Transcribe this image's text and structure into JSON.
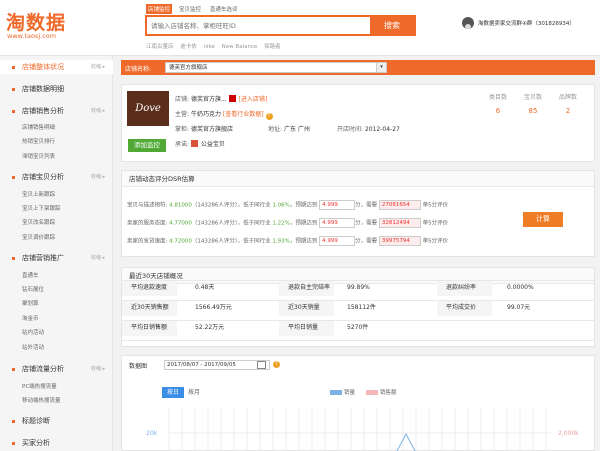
{
  "header": {
    "logo_main": "淘数据",
    "logo_url": "www.taosj.com",
    "tabs": [
      "店铺监控",
      "宝贝监控",
      "直通车选词"
    ],
    "search_placeholder": "请输入店铺名称、掌柜旺旺ID",
    "search_button": "搜索",
    "hot_keywords": [
      "江南古董店",
      "迪卡侬",
      "nike",
      "New Balance",
      "探路者"
    ],
    "qq_group": "淘数据卖家交流群④群（301826934）"
  },
  "sidebar": {
    "sections": [
      {
        "label": "店铺整体状况",
        "toggle": "收缩 ▸",
        "active": true,
        "items": []
      },
      {
        "label": "店铺数据明细",
        "toggle": "",
        "active": false,
        "items": []
      },
      {
        "label": "店铺销售分析",
        "toggle": "收缩 ▸",
        "active": false,
        "items": [
          "店铺销售明细",
          "热销宝贝排行",
          "滞销宝贝列表"
        ]
      },
      {
        "label": "店铺宝贝分析",
        "toggle": "收缩 ▸",
        "active": false,
        "items": [
          "宝贝上新跟踪",
          "宝贝上下架跟踪",
          "宝贝改名跟踪",
          "宝贝调价跟踪"
        ]
      },
      {
        "label": "店铺营销推广",
        "toggle": "收缩 ▸",
        "active": false,
        "items": [
          "直通车",
          "钻石展位",
          "聚划算",
          "淘金币",
          "站内活动",
          "站外活动"
        ]
      },
      {
        "label": "店铺流量分析",
        "toggle": "收缩 ▸",
        "active": false,
        "items": [
          "PC端热搜流量",
          "移动端热搜流量"
        ]
      },
      {
        "label": "标题诊断",
        "toggle": "",
        "active": false,
        "items": []
      },
      {
        "label": "买家分析",
        "toggle": "",
        "active": false,
        "items": []
      }
    ]
  },
  "shop_bar": {
    "label": "店铺名称:",
    "selected": "德芙官方旗舰店"
  },
  "shop": {
    "brand_logo": "Dove",
    "add_button": "添加监控",
    "name_label": "店铺:",
    "name_value": "德芙官方旗...",
    "enter_link": "[进入店铺]",
    "main_label": "主营:",
    "main_value": "牛奶巧克力",
    "industry_link": "[查看行业数据]",
    "owner_label": "掌柜:",
    "owner_value": "德芙官方旗舰店",
    "area_label": "地址:",
    "area_value": "广东 广州",
    "open_label": "开店时间:",
    "open_value": "2012-04-27",
    "cert_label": "承诺:",
    "cert_value": "公益宝贝",
    "stats": [
      {
        "label": "类目数",
        "value": "6"
      },
      {
        "label": "宝贝数",
        "value": "85"
      },
      {
        "label": "品牌数",
        "value": "2"
      }
    ]
  },
  "dsr": {
    "title": "店铺动态评分DSR估算",
    "rows": [
      {
        "prefix": "宝贝与描述相符: ",
        "score": "4.81000",
        "count": "（143286人评分）",
        "compare": "，低于同行业 ",
        "pct": "1.06%",
        "target_label": "，预期达到 ",
        "target": "4.999",
        "need_label": "分，需要 ",
        "need": "27081654",
        "suffix": " 单5分评价"
      },
      {
        "prefix": "卖家的服务态度: ",
        "score": "4.77000",
        "count": "（143286人评分）",
        "compare": "，低于同行业 ",
        "pct": "1.22%",
        "target_label": "，预期达到 ",
        "target": "4.999",
        "need_label": "分，需要 ",
        "need": "32812494",
        "suffix": " 单5分评价"
      },
      {
        "prefix": "卖家的发货速度: ",
        "score": "4.72000",
        "count": "（143286人评分）",
        "compare": "，低于同行业 ",
        "pct": "1.93%",
        "target_label": "，预期达到 ",
        "target": "4.999",
        "need_label": "分，需要 ",
        "need": "39975794",
        "suffix": " 单5分评价"
      }
    ],
    "button": "计算"
  },
  "overview": {
    "title": "最近30天店铺概况",
    "rows": [
      [
        {
          "k": "平均退款速度",
          "v": "0.48天"
        },
        {
          "k": "退款自主完结率",
          "v": "99.89%"
        },
        {
          "k": "退款纠纷率",
          "v": "0.0000%"
        }
      ],
      [
        {
          "k": "近30天销售额",
          "v": "1566.49万元"
        },
        {
          "k": "近30天销量",
          "v": "158112件"
        },
        {
          "k": "平均成交价",
          "v": "99.07元"
        }
      ],
      [
        {
          "k": "平均日销售额",
          "v": "52.22万元"
        },
        {
          "k": "平均日销量",
          "v": "5270件"
        }
      ]
    ]
  },
  "chart_panel": {
    "label": "数据图",
    "date_range": "2017/08/07 - 2017/09/05",
    "tab_day": "按日",
    "tab_month": "按月",
    "legend": [
      {
        "name": "销量",
        "color": "#7fb3e6"
      },
      {
        "name": "销售额",
        "color": "#f5b8b8"
      }
    ],
    "y_left_tick": "20k",
    "y_right_tick": "2,000k",
    "colors": {
      "line": "#7fb3e6",
      "grid": "#dddddd"
    }
  },
  "chart_data": {
    "type": "line",
    "series": [
      {
        "name": "销量",
        "values": []
      },
      {
        "name": "销售额",
        "values": []
      }
    ],
    "y_left_ticks": [
      "20k"
    ],
    "y_right_ticks": [
      "2,000k"
    ],
    "grid": true,
    "legend": "top-center"
  }
}
